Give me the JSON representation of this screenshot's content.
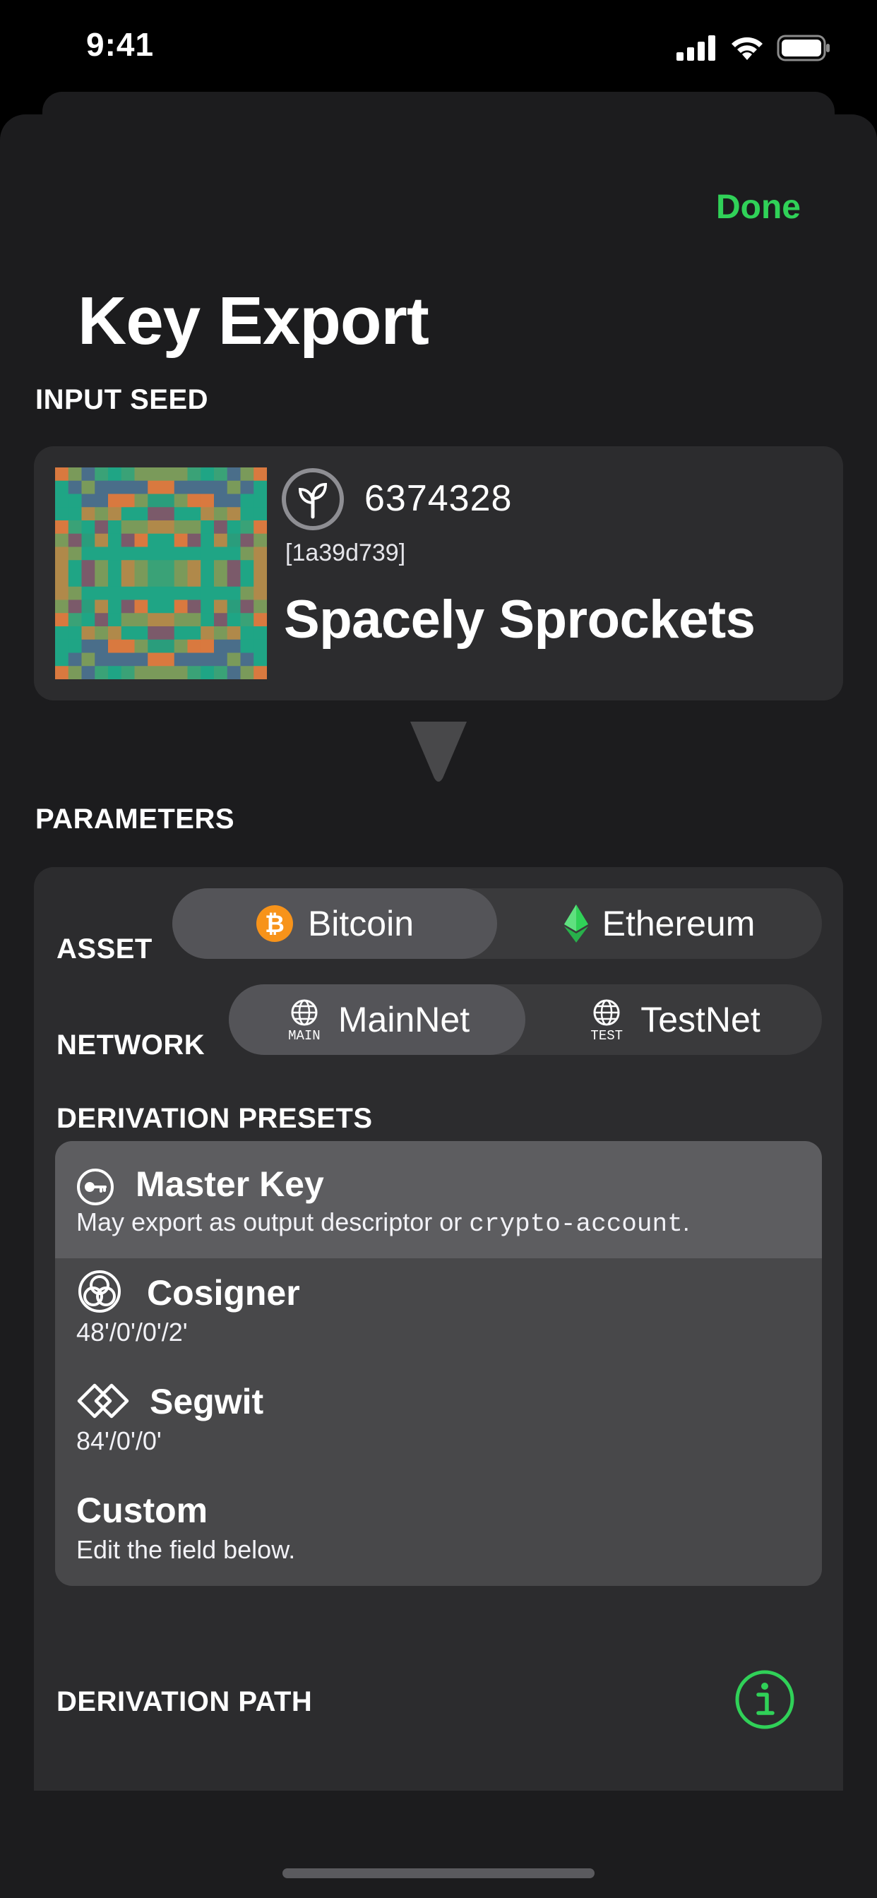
{
  "status_bar": {
    "time": "9:41"
  },
  "header": {
    "done_label": "Done",
    "title": "Key Export"
  },
  "input_seed": {
    "section_label": "INPUT SEED",
    "number": "6374328",
    "fingerprint": "[1a39d739]",
    "name": "Spacely Sprockets",
    "icon": "seed-sprout-icon"
  },
  "parameters": {
    "section_label": "PARAMETERS",
    "asset": {
      "label": "ASSET",
      "options": [
        {
          "label": "Bitcoin",
          "icon": "bitcoin-icon",
          "selected": true
        },
        {
          "label": "Ethereum",
          "icon": "ethereum-icon",
          "selected": false
        }
      ]
    },
    "network": {
      "label": "NETWORK",
      "options": [
        {
          "label": "MainNet",
          "badge": "MAIN",
          "icon": "globe-icon",
          "selected": true
        },
        {
          "label": "TestNet",
          "badge": "TEST",
          "icon": "globe-icon",
          "selected": false
        }
      ]
    },
    "derivation_presets": {
      "label": "DERIVATION PRESETS",
      "items": [
        {
          "title": "Master Key",
          "subtitle_prefix": "May export as output descriptor or ",
          "subtitle_code": "crypto-account",
          "subtitle_suffix": ".",
          "icon": "key-icon",
          "selected": true
        },
        {
          "title": "Cosigner",
          "subtitle": "48'/0'/0'/2'",
          "icon": "cosigner-icon",
          "selected": false
        },
        {
          "title": "Segwit",
          "subtitle": "84'/0'/0'",
          "icon": "segwit-icon",
          "selected": false
        },
        {
          "title": "Custom",
          "subtitle": "Edit the field below.",
          "selected": false
        }
      ]
    },
    "derivation_path": {
      "label": "DERIVATION PATH",
      "placeholder": "Derivation Path",
      "value": ""
    }
  },
  "colors": {
    "accent": "#30d158",
    "background": "#1c1c1e",
    "card": "#2c2c2e",
    "bitcoin": "#f7931a",
    "ethereum": "#30d158"
  }
}
